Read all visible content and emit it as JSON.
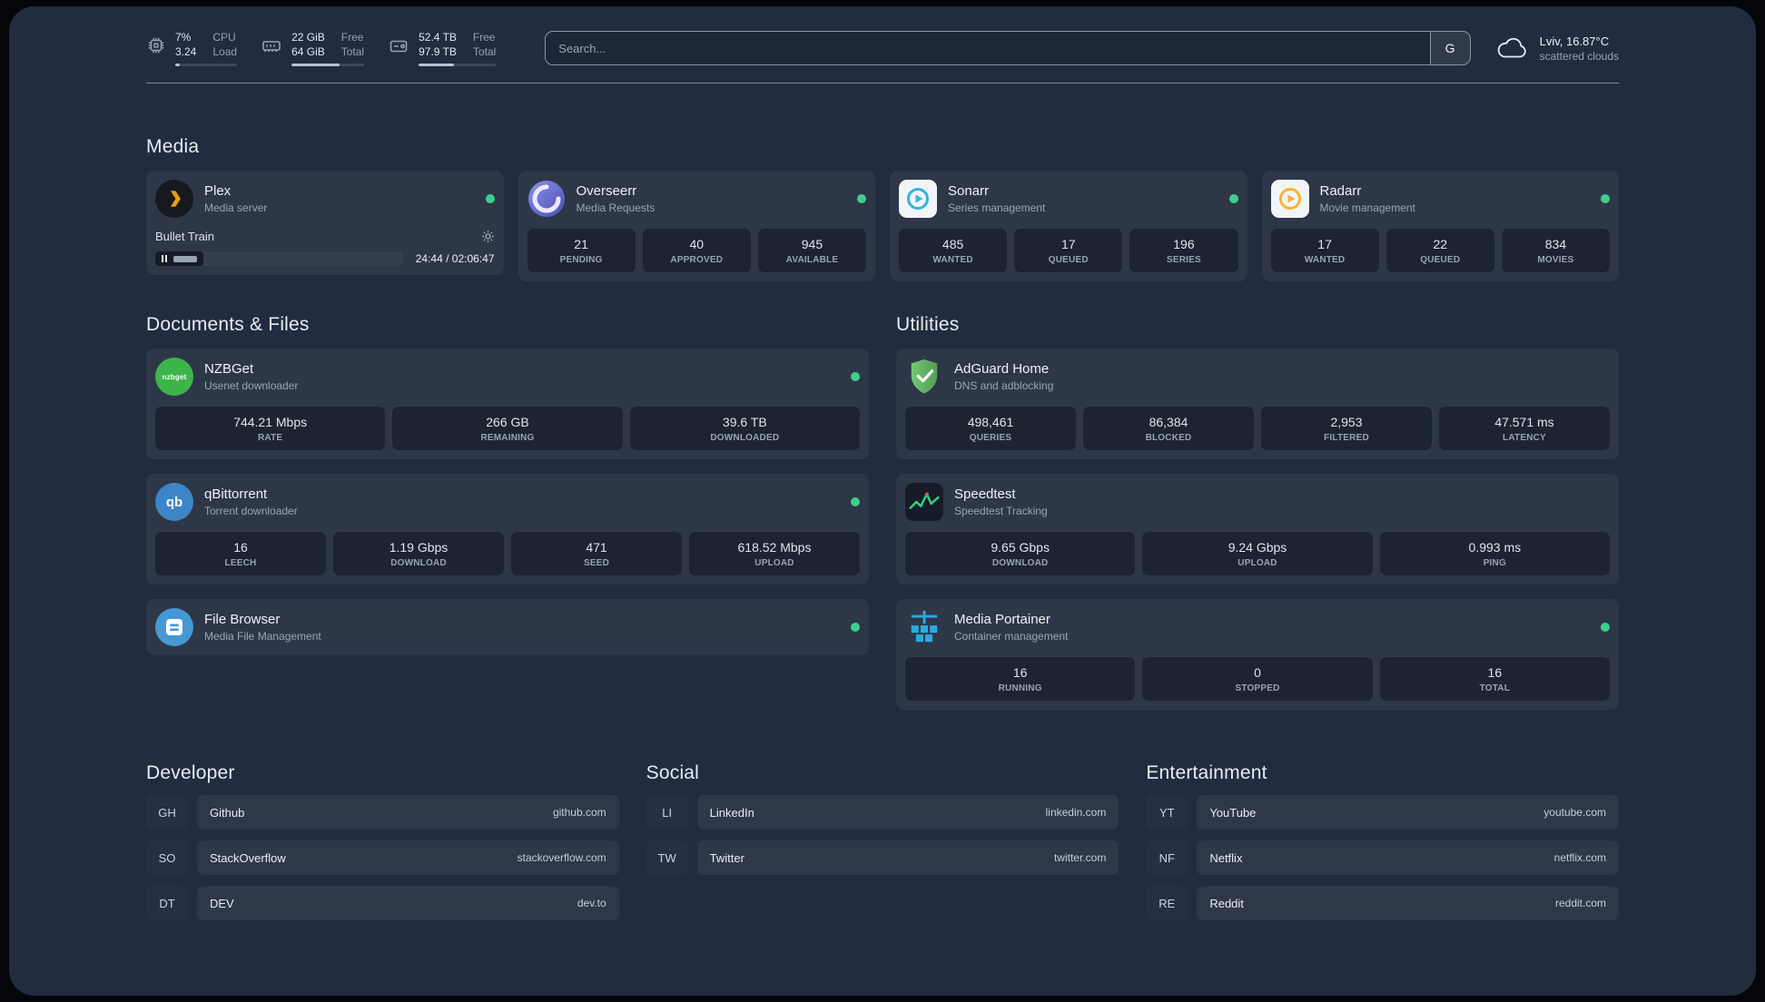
{
  "colors": {
    "app_background": "#212c3e",
    "status_online": "#3ecf8e",
    "plex": "#e5a00d",
    "overseerr": "#5d64c3",
    "sonarr": "#35b1e0",
    "radarr": "#f9b234",
    "nzbget": "#3db549",
    "qbittorrent": "#3d85c6",
    "filebrowser": "#4598d4",
    "adguard": "#68bc71",
    "speedtest": "#35d07f",
    "portainer": "#29abe2"
  },
  "topbar": {
    "resources": [
      {
        "id": "cpu",
        "values": [
          "7%",
          "3.24"
        ],
        "labels": [
          "CPU",
          "Load"
        ],
        "progress_pct": 7
      },
      {
        "id": "memory",
        "values": [
          "22 GiB",
          "64 GiB"
        ],
        "labels": [
          "Free",
          "Total"
        ],
        "progress_pct": 66
      },
      {
        "id": "disk",
        "values": [
          "52.4 TB",
          "97.9 TB"
        ],
        "labels": [
          "Free",
          "Total"
        ],
        "progress_pct": 46
      }
    ],
    "search": {
      "placeholder": "Search...",
      "provider": "G"
    },
    "weather": {
      "location": "Lviv, 16.87°C",
      "condition": "scattered clouds"
    }
  },
  "sections": {
    "media": {
      "title": "Media",
      "plex": {
        "title": "Plex",
        "subtitle": "Media server",
        "now_playing": "Bullet Train",
        "time": "24:44 / 02:06:47",
        "progress_pct": 19.5
      },
      "overseerr": {
        "title": "Overseerr",
        "subtitle": "Media Requests",
        "stats": [
          {
            "value": "21",
            "label": "PENDING"
          },
          {
            "value": "40",
            "label": "APPROVED"
          },
          {
            "value": "945",
            "label": "AVAILABLE"
          }
        ]
      },
      "sonarr": {
        "title": "Sonarr",
        "subtitle": "Series management",
        "stats": [
          {
            "value": "485",
            "label": "WANTED"
          },
          {
            "value": "17",
            "label": "QUEUED"
          },
          {
            "value": "196",
            "label": "SERIES"
          }
        ]
      },
      "radarr": {
        "title": "Radarr",
        "subtitle": "Movie management",
        "stats": [
          {
            "value": "17",
            "label": "WANTED"
          },
          {
            "value": "22",
            "label": "QUEUED"
          },
          {
            "value": "834",
            "label": "MOVIES"
          }
        ]
      }
    },
    "documents": {
      "title": "Documents & Files",
      "nzbget": {
        "title": "NZBGet",
        "subtitle": "Usenet downloader",
        "icon_text": "nzbget",
        "stats": [
          {
            "value": "744.21 Mbps",
            "label": "RATE"
          },
          {
            "value": "266 GB",
            "label": "REMAINING"
          },
          {
            "value": "39.6 TB",
            "label": "DOWNLOADED"
          }
        ]
      },
      "qbittorrent": {
        "title": "qBittorrent",
        "subtitle": "Torrent downloader",
        "icon_text": "qb",
        "stats": [
          {
            "value": "16",
            "label": "LEECH"
          },
          {
            "value": "1.19 Gbps",
            "label": "DOWNLOAD"
          },
          {
            "value": "471",
            "label": "SEED"
          },
          {
            "value": "618.52 Mbps",
            "label": "UPLOAD"
          }
        ]
      },
      "filebrowser": {
        "title": "File Browser",
        "subtitle": "Media File Management"
      }
    },
    "utilities": {
      "title": "Utilities",
      "adguard": {
        "title": "AdGuard Home",
        "subtitle": "DNS and adblocking",
        "stats": [
          {
            "value": "498,461",
            "label": "QUERIES"
          },
          {
            "value": "86,384",
            "label": "BLOCKED"
          },
          {
            "value": "2,953",
            "label": "FILTERED"
          },
          {
            "value": "47.571 ms",
            "label": "LATENCY"
          }
        ]
      },
      "speedtest": {
        "title": "Speedtest",
        "subtitle": "Speedtest Tracking",
        "stats": [
          {
            "value": "9.65 Gbps",
            "label": "DOWNLOAD"
          },
          {
            "value": "9.24 Gbps",
            "label": "UPLOAD"
          },
          {
            "value": "0.993 ms",
            "label": "PING"
          }
        ]
      },
      "portainer": {
        "title": "Media Portainer",
        "subtitle": "Container management",
        "stats": [
          {
            "value": "16",
            "label": "RUNNING"
          },
          {
            "value": "0",
            "label": "STOPPED"
          },
          {
            "value": "16",
            "label": "TOTAL"
          }
        ]
      }
    },
    "bookmarks": [
      {
        "title": "Developer",
        "items": [
          {
            "abbr": "GH",
            "name": "Github",
            "domain": "github.com"
          },
          {
            "abbr": "SO",
            "name": "StackOverflow",
            "domain": "stackoverflow.com"
          },
          {
            "abbr": "DT",
            "name": "DEV",
            "domain": "dev.to"
          }
        ]
      },
      {
        "title": "Social",
        "items": [
          {
            "abbr": "LI",
            "name": "LinkedIn",
            "domain": "linkedin.com"
          },
          {
            "abbr": "TW",
            "name": "Twitter",
            "domain": "twitter.com"
          }
        ]
      },
      {
        "title": "Entertainment",
        "items": [
          {
            "abbr": "YT",
            "name": "YouTube",
            "domain": "youtube.com"
          },
          {
            "abbr": "NF",
            "name": "Netflix",
            "domain": "netflix.com"
          },
          {
            "abbr": "RE",
            "name": "Reddit",
            "domain": "reddit.com"
          }
        ]
      }
    ]
  }
}
